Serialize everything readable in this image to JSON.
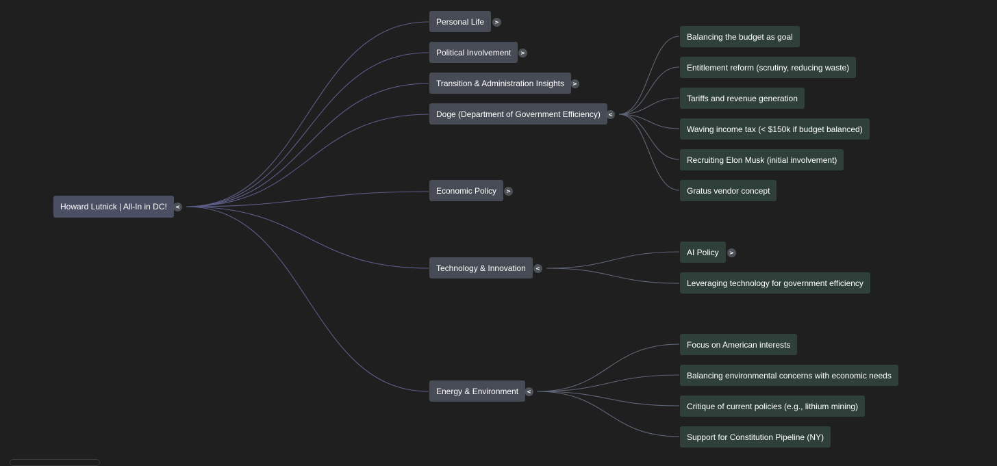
{
  "mindmap": {
    "root": {
      "label": "Howard Lutnick | All-In in DC!",
      "toggle": "<"
    },
    "branches": [
      {
        "label": "Personal Life",
        "toggle": ">"
      },
      {
        "label": "Political Involvement",
        "toggle": ">"
      },
      {
        "label": "Transition & Administration Insights",
        "toggle": ">"
      },
      {
        "label": "Doge (Department of Government Efficiency)",
        "toggle": "<",
        "children": [
          "Balancing the budget as goal",
          "Entitlement reform (scrutiny, reducing waste)",
          "Tariffs and revenue generation",
          "Waving income tax (< $150k if budget balanced)",
          "Recruiting Elon Musk (initial involvement)",
          "Gratus vendor concept"
        ]
      },
      {
        "label": "Economic Policy",
        "toggle": ">"
      },
      {
        "label": "Technology & Innovation",
        "toggle": "<",
        "children": [
          "AI Policy",
          "Leveraging technology for government efficiency"
        ],
        "child_toggle": ">"
      },
      {
        "label": "Energy & Environment",
        "toggle": "<",
        "children": [
          "Focus on American interests",
          "Balancing environmental concerns with economic needs",
          "Critique of current policies (e.g., lithium mining)",
          "Support for Constitution Pipeline (NY)"
        ]
      }
    ]
  },
  "colors": {
    "background": "#1f1f1f",
    "root_node": "#4b4f64",
    "branch_node": "#464b55",
    "leaf_node": "#2f403b",
    "edge_root": "#5d5f8a",
    "edge_branch": "#5f6776"
  }
}
